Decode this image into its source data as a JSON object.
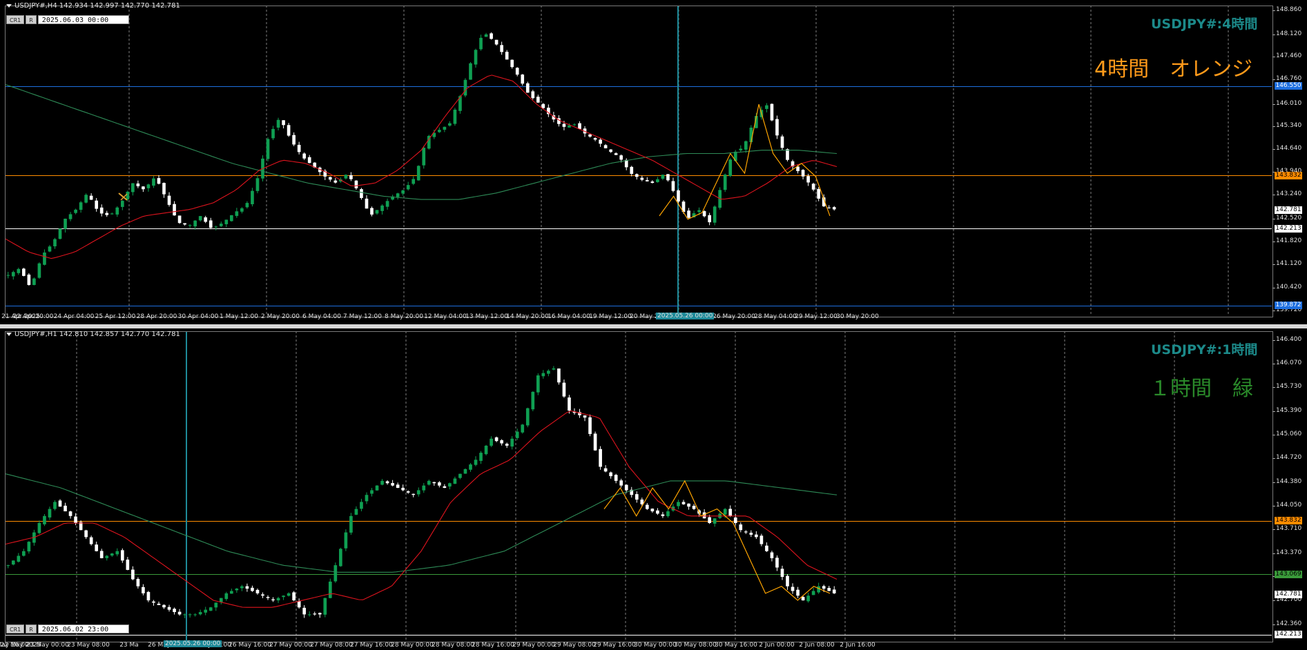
{
  "colors": {
    "background": "#000000",
    "grid": "#a0a0a0",
    "candle_up": "#0f9f52",
    "candle_down": "#ffffff",
    "ma_fast": "#e0141e",
    "ma_slow": "#2e8b57",
    "zigzag": "#ffa500",
    "line_orange": "#ff8c00",
    "line_blue": "#1e6fe0",
    "line_white": "#ffffff",
    "line_green": "#3a9a3a",
    "cursor_line": "#1e8b9a",
    "title_teal": "#1c8a8a",
    "label_orange": "#ff9a1a",
    "label_green": "#2a8a2a"
  },
  "charts": [
    {
      "id": "h4",
      "header": "USDJPY#,H4  142.934 142.997 142.770 142.781",
      "toolbar": {
        "btn1": "CR1",
        "btn2": "R",
        "date": "2025.06.03 00:00"
      },
      "title": "USDJPY#:4時間",
      "label": "4時間　オレンジ",
      "price_axis": [
        "148.860",
        "148.120",
        "147.460",
        "146.760",
        "146.010",
        "145.340",
        "144.640",
        "143.940",
        "143.240",
        "142.520",
        "141.820",
        "141.120",
        "140.420",
        "139.720"
      ],
      "price_tags": [
        {
          "value": 146.55,
          "text": "146.550",
          "bg": "#1e6fe0",
          "fg": "#ffffff"
        },
        {
          "value": 143.832,
          "text": "143.832",
          "bg": "#ff8c00",
          "fg": "#000000"
        },
        {
          "value": 142.781,
          "text": "142.781",
          "bg": "#ffffff",
          "fg": "#000000"
        },
        {
          "value": 142.213,
          "text": "142.213",
          "bg": "#ffffff",
          "fg": "#000000"
        },
        {
          "value": 139.872,
          "text": "139.872",
          "bg": "#1e6fe0",
          "fg": "#ffffff"
        }
      ],
      "hlines": [
        {
          "value": 146.55,
          "color": "#1e6fe0"
        },
        {
          "value": 143.832,
          "color": "#ff8c00"
        },
        {
          "value": 142.213,
          "color": "#ffffff"
        },
        {
          "value": 139.872,
          "color": "#1e6fe0"
        }
      ],
      "time_axis": [
        "21 Apr 2025",
        "22 Apr 20:00",
        "24 Apr 04:00",
        "25 Apr 12:00",
        "28 Apr 20:00",
        "30 Apr 04:00",
        "1 May 12:00",
        "2 May 20:00",
        "6 May 04:00",
        "7 May 12:00",
        "8 May 20:00",
        "12 May 04:00",
        "13 May 12:00",
        "14 May 20:00",
        "16 May 04:00",
        "19 May 12:00",
        "20 May 20:00",
        "22 May 04:",
        "26 May 20:00",
        "28 May 04:00",
        "29 May 12:00",
        "30 May 20:00"
      ],
      "cursor_time": "2025.05.26 00:00",
      "chart_data": {
        "type": "candlestick",
        "ylim": [
          139.72,
          148.86
        ],
        "price_path": [
          140.8,
          141.0,
          140.4,
          141.4,
          141.8,
          142.5,
          142.8,
          143.3,
          142.7,
          142.6,
          143.0,
          143.6,
          143.4,
          143.8,
          143.1,
          142.4,
          142.3,
          142.6,
          142.2,
          142.4,
          142.7,
          142.9,
          143.7,
          145.0,
          145.6,
          144.9,
          144.4,
          144.1,
          143.8,
          143.6,
          143.9,
          143.3,
          142.6,
          142.9,
          143.2,
          143.4,
          143.8,
          145.0,
          145.2,
          145.4,
          146.3,
          147.4,
          148.2,
          147.9,
          147.4,
          146.9,
          146.3,
          146.0,
          145.6,
          145.3,
          145.4,
          145.1,
          144.9,
          144.6,
          144.4,
          143.9,
          143.7,
          143.6,
          143.9,
          143.2,
          142.5,
          142.8,
          142.4,
          143.5,
          144.5,
          144.7,
          145.6,
          146.0,
          145.0,
          144.2,
          143.9,
          143.5,
          142.9,
          142.8
        ],
        "ma_fast_path": [
          141.9,
          141.5,
          141.3,
          141.5,
          141.9,
          142.3,
          142.6,
          142.7,
          142.8,
          143.0,
          143.4,
          144.0,
          144.3,
          144.2,
          143.9,
          143.5,
          143.6,
          144.0,
          144.6,
          145.6,
          146.5,
          146.9,
          146.7,
          146.0,
          145.5,
          145.2,
          144.9,
          144.6,
          144.3,
          143.9,
          143.5,
          143.1,
          143.2,
          143.6,
          144.1,
          144.3,
          144.1
        ],
        "ma_slow_path": [
          146.6,
          146.2,
          145.8,
          145.4,
          145.0,
          144.6,
          144.2,
          143.9,
          143.6,
          143.4,
          143.2,
          143.1,
          143.1,
          143.3,
          143.6,
          143.9,
          144.2,
          144.4,
          144.5,
          144.5,
          144.6,
          144.6,
          144.5
        ],
        "zigzag_path": [
          142.6,
          143.2,
          142.5,
          142.7,
          143.6,
          144.5,
          143.9,
          146.0,
          144.5,
          143.9,
          144.2,
          143.8,
          142.6
        ]
      }
    },
    {
      "id": "h1",
      "header": "USDJPY#,H1  142.810 142.857 142.770 142.781",
      "toolbar": {
        "btn1": "CR1",
        "btn2": "R",
        "date": "2025.06.02 23:00"
      },
      "title": "USDJPY#:1時間",
      "label": "１時間　緑",
      "price_axis": [
        "146.400",
        "146.070",
        "145.730",
        "145.390",
        "145.060",
        "144.720",
        "144.380",
        "144.050",
        "143.710",
        "143.370",
        "143.040",
        "142.700",
        "142.360"
      ],
      "price_tags": [
        {
          "value": 143.832,
          "text": "143.832",
          "bg": "#ff8c00",
          "fg": "#000000"
        },
        {
          "value": 143.069,
          "text": "143.069",
          "bg": "#3a9a3a",
          "fg": "#000000"
        },
        {
          "value": 142.781,
          "text": "142.781",
          "bg": "#ffffff",
          "fg": "#000000"
        },
        {
          "value": 142.213,
          "text": "142.213",
          "bg": "#ffffff",
          "fg": "#000000"
        }
      ],
      "hlines": [
        {
          "value": 143.832,
          "color": "#ff8c00"
        },
        {
          "value": 143.069,
          "color": "#3a9a3a"
        },
        {
          "value": 142.213,
          "color": "#ffffff"
        }
      ],
      "time_axis": [
        "22 May 2025",
        "22 May 16:00",
        "23 May 00:00",
        "23 May 08:00",
        "23 Ma",
        "26 May 00:00",
        "26 May 08:00",
        "26 May 16:00",
        "27 May 00:00",
        "27 May 08:00",
        "27 May 16:00",
        "28 May 00:00",
        "28 May 08:00",
        "28 May 16:00",
        "29 May 00:00",
        "29 May 08:00",
        "29 May 16:00",
        "30 May 00:00",
        "30 May 08:00",
        "30 May 16:00",
        "2 Jun 00:00",
        "2 Jun 08:00",
        "2 Jun 16:00"
      ],
      "cursor_time": "2025.05.26 00:00",
      "chart_data": {
        "type": "candlestick",
        "ylim": [
          142.19,
          146.47
        ],
        "price_path": [
          143.2,
          143.4,
          143.8,
          144.1,
          143.9,
          143.6,
          143.3,
          143.4,
          143.0,
          142.7,
          142.6,
          142.5,
          142.5,
          142.6,
          142.8,
          142.9,
          142.8,
          142.7,
          142.8,
          142.5,
          142.5,
          143.2,
          143.9,
          144.2,
          144.4,
          144.3,
          144.2,
          144.4,
          144.3,
          144.5,
          144.7,
          145.0,
          144.9,
          145.2,
          145.9,
          146.0,
          145.4,
          145.3,
          144.6,
          144.4,
          144.2,
          144.0,
          143.9,
          144.1,
          144.0,
          143.8,
          144.0,
          143.7,
          143.6,
          143.3,
          142.9,
          142.7,
          142.9,
          142.8
        ],
        "ma_fast_path": [
          143.5,
          143.6,
          143.8,
          143.8,
          143.6,
          143.3,
          143.0,
          142.7,
          142.6,
          142.6,
          142.7,
          142.8,
          142.7,
          142.9,
          143.4,
          144.1,
          144.5,
          144.7,
          145.1,
          145.4,
          145.3,
          144.6,
          144.1,
          143.9,
          143.9,
          143.9,
          143.6,
          143.2,
          143.0
        ],
        "ma_slow_path": [
          144.5,
          144.3,
          144.0,
          143.7,
          143.4,
          143.2,
          143.1,
          143.1,
          143.2,
          143.4,
          143.8,
          144.2,
          144.4,
          144.4,
          144.3,
          144.2
        ],
        "zigzag_path": [
          144.0,
          144.3,
          143.9,
          144.3,
          144.0,
          144.4,
          143.9,
          144.0,
          143.8,
          143.3,
          142.8,
          142.9,
          142.7,
          142.9,
          142.8
        ]
      }
    }
  ]
}
